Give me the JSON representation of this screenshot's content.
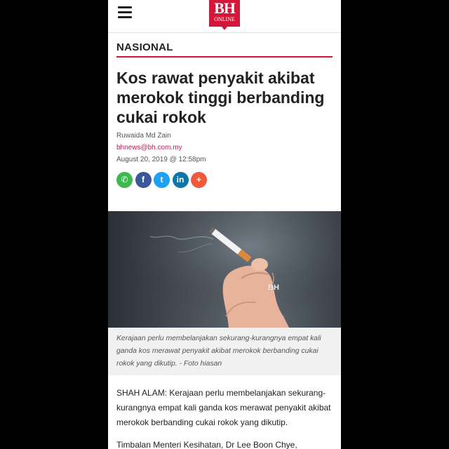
{
  "header": {
    "logo_main": "BH",
    "logo_sub": "ONLINE"
  },
  "section": "NASIONAL",
  "article": {
    "headline": "Kos rawat penyakit akibat merokok tinggi berbanding cukai rokok",
    "author": "Ruwaida Md Zain",
    "email": "bhnews@bh.com.my",
    "date": "August 20, 2019 @ 12:58pm",
    "photo_watermark": "BH",
    "caption": "Kerajaan perlu membelanjakan sekurang-kurangnya empat kali ganda kos merawat penyakit akibat merokok berbanding cukai rokok yang dikutip. - Foto hiasan",
    "paragraph1": "SHAH ALAM: Kerajaan perlu membelanjakan sekurang-kurangnya empat kali ganda kos merawat penyakit akibat merokok berbanding cukai rokok yang dikutip.",
    "paragraph2": "Timbalan Menteri Kesihatan, Dr Lee Boon Chye,"
  },
  "share": [
    {
      "name": "whatsapp",
      "icon": "whatsapp-icon",
      "glyph": "✆",
      "color": "#3fb94f"
    },
    {
      "name": "facebook",
      "icon": "facebook-icon",
      "glyph": "f",
      "color": "#3b5998"
    },
    {
      "name": "twitter",
      "icon": "twitter-icon",
      "glyph": "t",
      "color": "#1da1f2"
    },
    {
      "name": "linkedin",
      "icon": "linkedin-icon",
      "glyph": "in",
      "color": "#0e76a8"
    },
    {
      "name": "more",
      "icon": "plus-icon",
      "glyph": "+",
      "color": "#f05a3c"
    }
  ],
  "colors": {
    "brand": "#d3173a",
    "email_link": "#c2185b"
  }
}
